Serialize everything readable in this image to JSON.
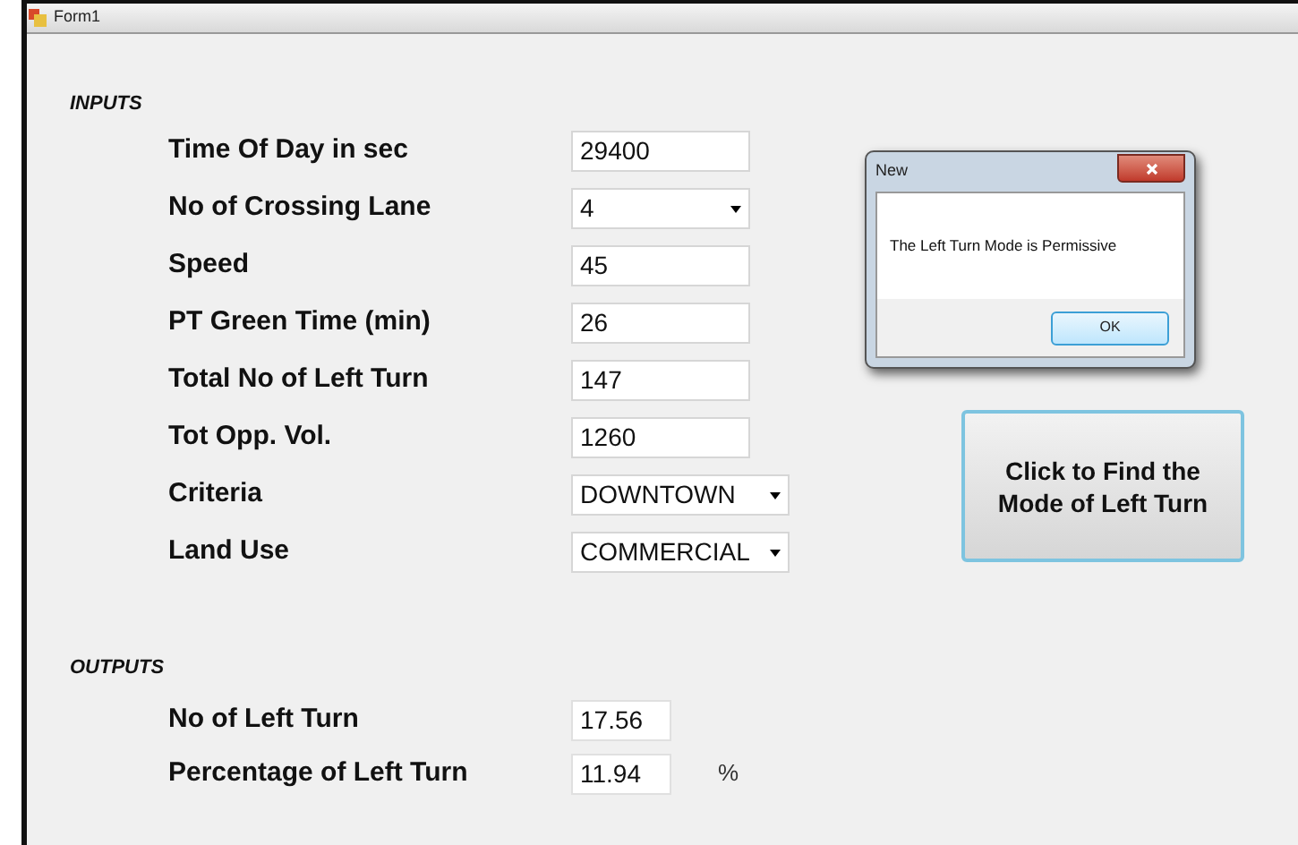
{
  "window": {
    "title": "Form1"
  },
  "inputs": {
    "heading": "INPUTS",
    "fields": [
      {
        "label": "Time Of Day in sec",
        "kind": "text",
        "value": "29400"
      },
      {
        "label": "No of Crossing Lane",
        "kind": "combo",
        "value": "4"
      },
      {
        "label": "Speed",
        "kind": "text",
        "value": "45"
      },
      {
        "label": "PT Green Time (min)",
        "kind": "text",
        "value": "26"
      },
      {
        "label": "Total No of Left Turn",
        "kind": "text",
        "value": "147"
      },
      {
        "label": "Tot Opp. Vol.",
        "kind": "text",
        "value": "1260"
      },
      {
        "label": "Criteria",
        "kind": "combo",
        "value": "DOWNTOWN"
      },
      {
        "label": "Land Use",
        "kind": "combo",
        "value": "COMMERCIAL"
      }
    ]
  },
  "outputs": {
    "heading": "OUTPUTS",
    "fields": [
      {
        "label": "No of Left Turn",
        "value": "17.56"
      },
      {
        "label": "Percentage of Left Turn",
        "value": "11.94",
        "unit": "%"
      }
    ]
  },
  "action_button": {
    "label": "Click to Find the Mode of Left Turn"
  },
  "dialog": {
    "title": "New",
    "message": "The Left Turn Mode is Permissive",
    "button": "OK"
  }
}
